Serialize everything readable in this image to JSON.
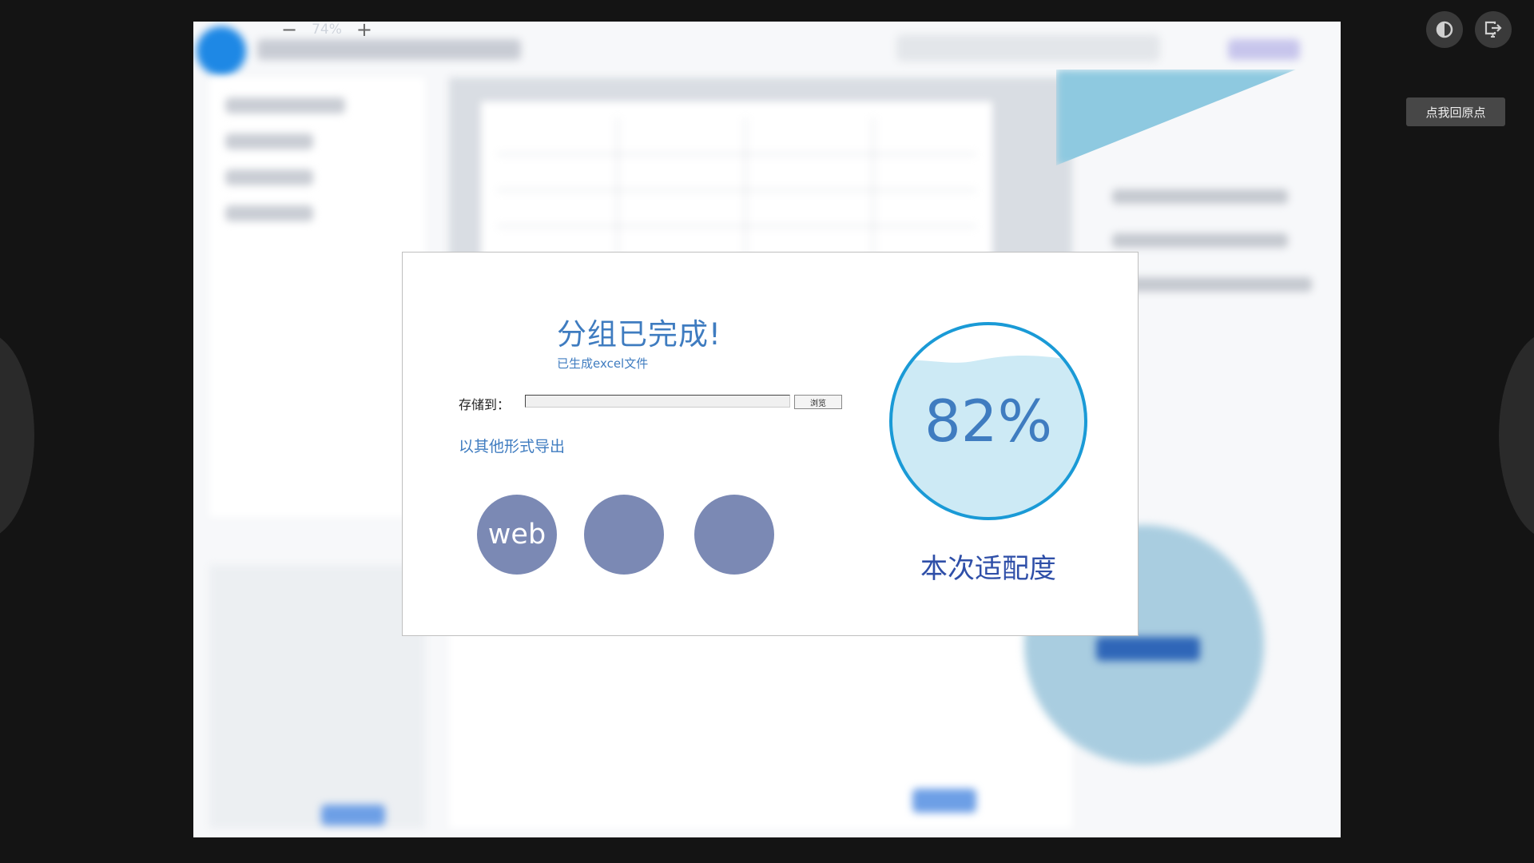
{
  "zoom": {
    "out_label": "−",
    "level": "74%",
    "in_label": "+"
  },
  "controls": {
    "reset_origin_label": "点我回原点",
    "contrast_icon": "contrast-icon",
    "exit_icon": "exit-icon"
  },
  "dialog": {
    "title": "分组已完成!",
    "subtitle": "已生成excel文件",
    "save_to_label": "存储到：",
    "save_path_value": "",
    "browse_label": "浏览",
    "export_other_label": "以其他形式导出",
    "export_formats": [
      "web",
      "",
      ""
    ],
    "fit_percent": 0.82,
    "fit_value_label": "82%",
    "fit_caption": "本次适配度",
    "colors": {
      "accent": "#3f7cc0",
      "gauge_ring": "#1a9ad6",
      "gauge_fill": "#cdeaf5",
      "format_circle": "#7b89b4"
    }
  }
}
